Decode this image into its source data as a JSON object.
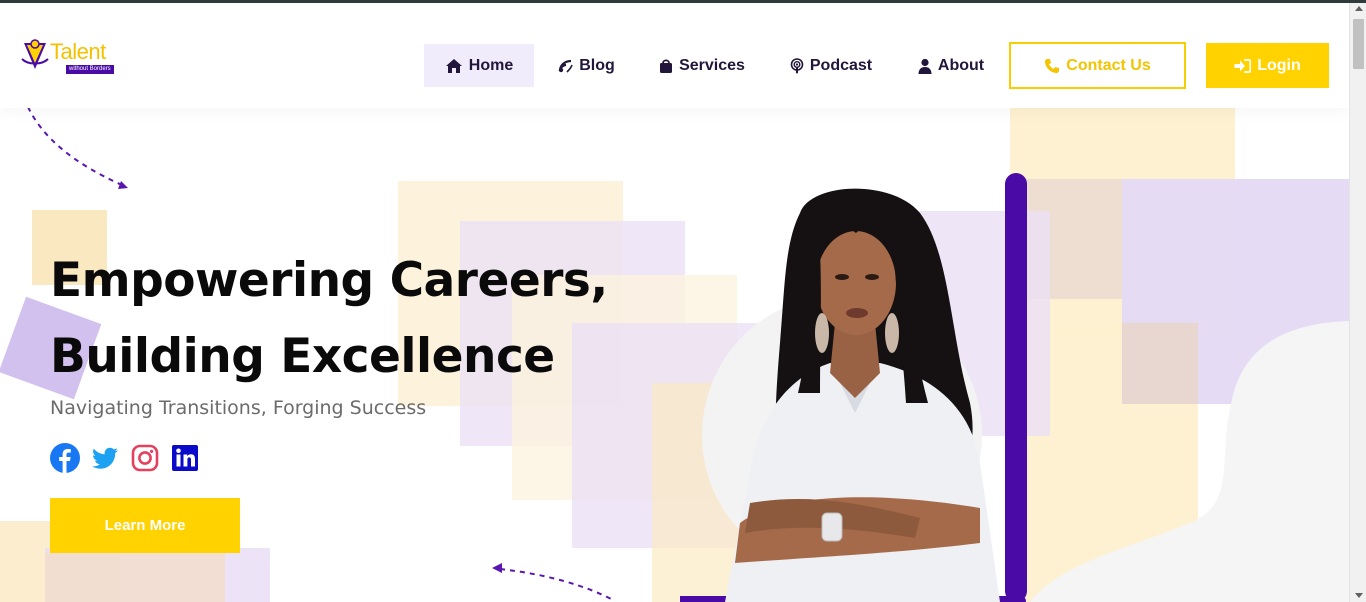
{
  "brand": {
    "name": "Talent",
    "tagline": "without Borders",
    "logo_icon": "person-diamond-icon"
  },
  "nav": {
    "items": [
      {
        "label": "Home",
        "icon": "home-icon",
        "active": true
      },
      {
        "label": "Blog",
        "icon": "blog-icon",
        "active": false
      },
      {
        "label": "Services",
        "icon": "bag-icon",
        "active": false
      },
      {
        "label": "Podcast",
        "icon": "podcast-icon",
        "active": false
      },
      {
        "label": "About",
        "icon": "user-icon",
        "active": false
      }
    ],
    "contact_label": "Contact Us",
    "login_label": "Login"
  },
  "hero": {
    "title_line1": "Empowering Careers,",
    "title_line2": "Building Excellence",
    "subtitle": "Navigating Transitions, Forging Success",
    "cta_label": "Learn More",
    "socials": [
      "facebook-icon",
      "twitter-icon",
      "instagram-icon",
      "linkedin-icon"
    ]
  },
  "colors": {
    "accent_yellow": "#ffd200",
    "accent_purple": "#4a0aa6",
    "text_dark": "#0a0a0a",
    "nav_active_bg": "#f1ecfb"
  }
}
